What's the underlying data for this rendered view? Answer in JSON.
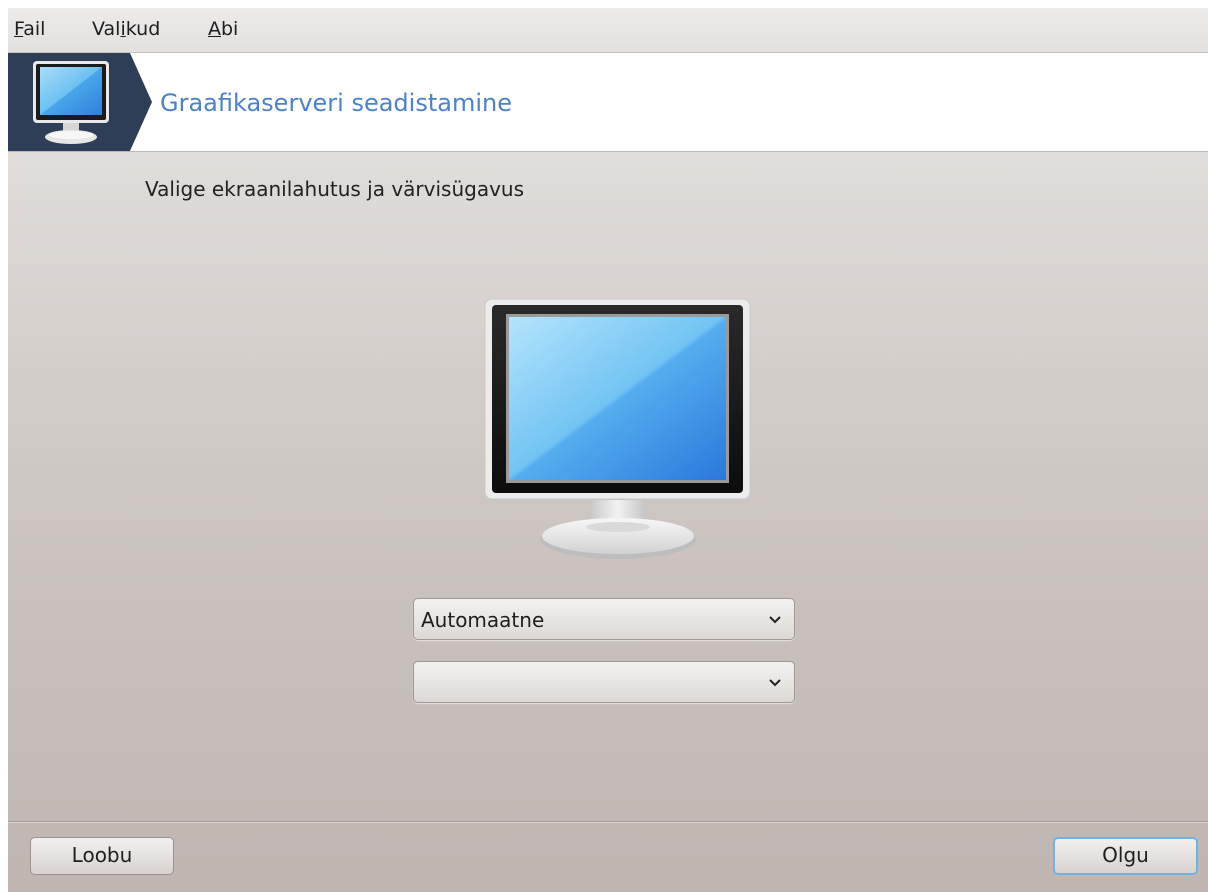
{
  "menubar": {
    "items": [
      {
        "mnemonic": "F",
        "rest": "ail"
      },
      {
        "prefix": "Val",
        "mnemonic": "i",
        "rest": "kud"
      },
      {
        "mnemonic": "A",
        "rest": "bi"
      }
    ]
  },
  "banner": {
    "title": "Graafikaserveri seadistamine",
    "icon": "monitor-icon"
  },
  "main": {
    "prompt": "Valige ekraanilahutus ja värvisügavus",
    "illustration": "monitor-icon",
    "resolution_select": {
      "value": "Automaatne"
    },
    "color_depth_select": {
      "value": ""
    }
  },
  "buttons": {
    "cancel_label": "Loobu",
    "ok_label": "Olgu"
  },
  "colors": {
    "banner_title": "#4b82c8",
    "banner_icon_bg": "#2e3e56",
    "default_button_border": "#6fb3e3"
  }
}
